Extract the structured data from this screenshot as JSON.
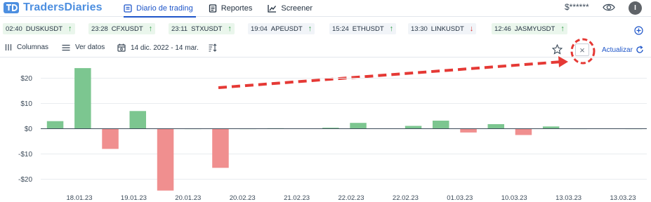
{
  "app": {
    "name": "TradersDiaries"
  },
  "nav": [
    {
      "label": "Diario de trading",
      "active": true,
      "icon": "journal-icon"
    },
    {
      "label": "Reportes",
      "active": false,
      "icon": "report-icon"
    },
    {
      "label": "Screener",
      "active": false,
      "icon": "chart-icon"
    }
  ],
  "header": {
    "balance_masked": "$******",
    "avatar_initial": "I"
  },
  "tickers": [
    {
      "time": "02:40",
      "symbol": "DUSKUSDT",
      "direction": "up"
    },
    {
      "time": "23:28",
      "symbol": "CFXUSDT",
      "direction": "up"
    },
    {
      "time": "23:11",
      "symbol": "STXUSDT",
      "direction": "up"
    },
    {
      "time": "19:04",
      "symbol": "APEUSDT",
      "direction": "up"
    },
    {
      "time": "15:24",
      "symbol": "ETHUSDT",
      "direction": "up"
    },
    {
      "time": "13:30",
      "symbol": "LINKUSDT",
      "direction": "down"
    },
    {
      "time": "12:46",
      "symbol": "JASMYUSDT",
      "direction": "up"
    }
  ],
  "toolbar": {
    "columns_label": "Columnas",
    "view_data_label": "Ver datos",
    "date_range": "14 dic. 2022 - 14 mar.",
    "refresh_label": "Actualizar",
    "close_symbol": "×"
  },
  "colors": {
    "positive": "#7cc690",
    "negative": "#f08f8f",
    "accent": "#1f56c9",
    "annotation": "#e53935"
  },
  "chart_data": {
    "type": "bar",
    "ylim": [
      -25,
      25
    ],
    "yticks": [
      20,
      10,
      0,
      -10,
      -20
    ],
    "ytick_labels": [
      "$20",
      "$10",
      "$0",
      "-$10",
      "-$20"
    ],
    "values": [
      3,
      24,
      -8,
      7,
      -24.5,
      0,
      -15.5,
      0,
      0.2,
      0.1,
      0.4,
      2.3,
      0.1,
      1.1,
      3.2,
      -1.5,
      1.8,
      -2.5,
      0.9,
      0,
      0.1,
      0
    ],
    "xtick_labels": [
      "18.01.23",
      "19.01.23",
      "20.01.23",
      "20.02.23",
      "21.02.23",
      "22.02.23",
      "22.02.23",
      "01.03.23",
      "10.03.23",
      "13.03.23",
      "13.03.23"
    ],
    "grid": true
  }
}
